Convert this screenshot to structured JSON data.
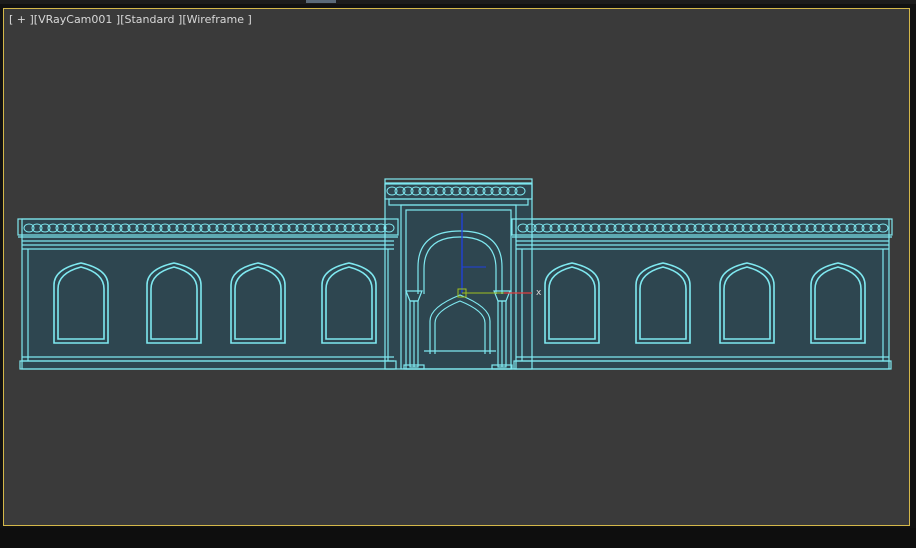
{
  "viewport": {
    "plus_label": "[ + ]",
    "camera_label": "[VRayCam001 ]",
    "shading_label": "[Standard ]",
    "mode_label": "[Wireframe ]",
    "gizmo_x_label": "x",
    "colors": {
      "background": "#3a3a3a",
      "border": "#d4b84a",
      "wireframe": "#7fe8f0",
      "wall_fill": "#2e4650",
      "gizmo_x": "#e04040",
      "gizmo_y": "#a0c020",
      "gizmo_z": "#2040e0"
    }
  }
}
